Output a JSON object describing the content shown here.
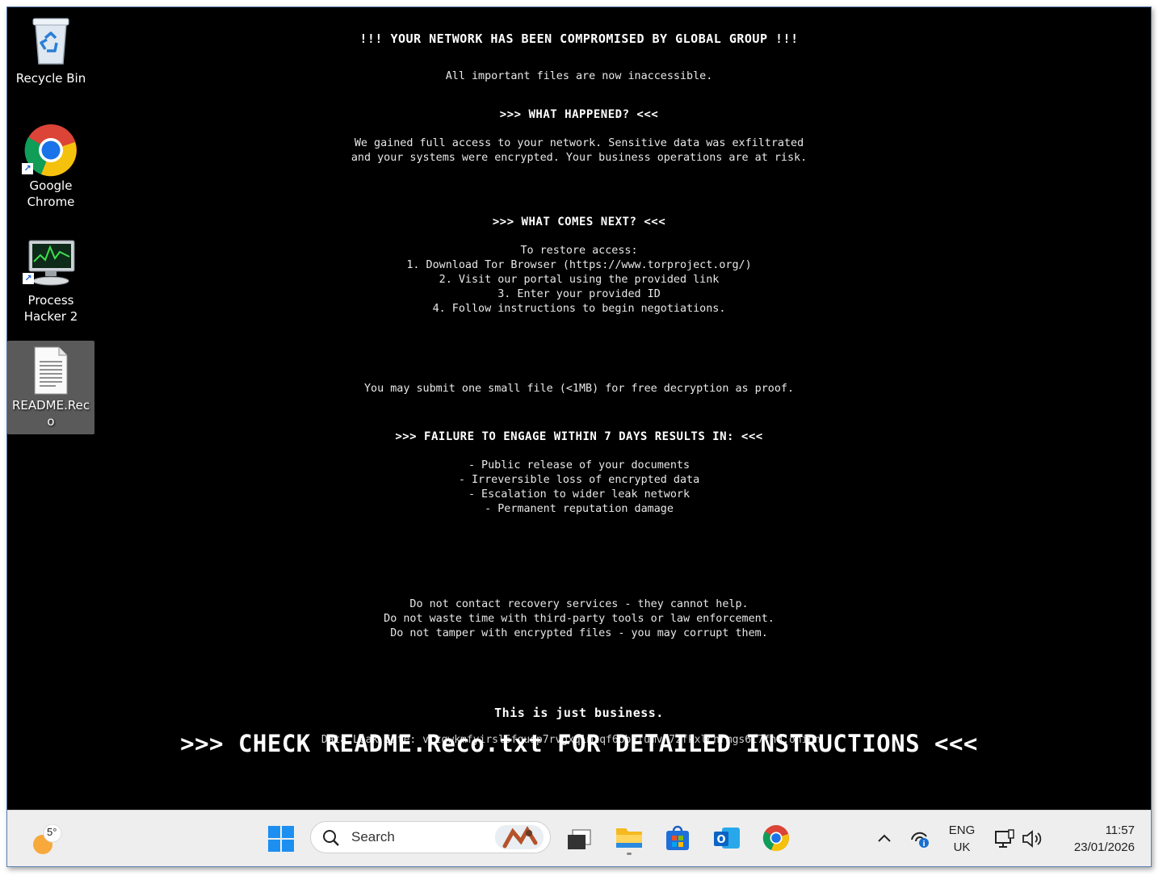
{
  "desktop": {
    "icons": [
      {
        "label": "Recycle Bin"
      },
      {
        "label": "Google\nChrome"
      },
      {
        "label": "Process\nHacker 2"
      },
      {
        "label": "README.Rec\no"
      }
    ]
  },
  "note": {
    "title": "!!! YOUR NETWORK HAS BEEN COMPROMISED BY GLOBAL GROUP !!!",
    "subtitle": "All important files are now inaccessible.",
    "what_happened_heading": ">>> WHAT HAPPENED? <<<",
    "what_happened_body": "We gained full access to your network. Sensitive data was exfiltrated\nand your systems were encrypted. Your business operations are at risk.",
    "next_heading": ">>> WHAT COMES NEXT? <<<",
    "next_body": "To restore access:\n1. Download Tor Browser (https://www.torproject.org/)\n2. Visit our portal using the provided link\n3. Enter your provided ID\n4. Follow instructions to begin negotiations.",
    "proof": "You may submit one small file (<1MB) for free decryption as proof.",
    "failure_heading": ">>> FAILURE TO ENGAGE WITHIN 7 DAYS RESULTS IN: <<<",
    "failure_body": "- Public release of your documents\n- Irreversible loss of encrypted data\n- Escalation to wider leak network\n- Permanent reputation damage",
    "warnings": "Do not contact recovery services - they cannot help.\nDo not waste time with third-party tools or law enforcement.\nDo not tamper with encrypted files - you may corrupt them.",
    "closing": "This is just business.",
    "check_readme": ">>> CHECK README.Reco.txt FOR DETAILED INSTRUCTIONS <<<",
    "leak_line_partial": "Data Leak Site: vlzgwkmfyirsl6fqusp7rvgxqlmzqf6obyfumvh7zfkxlcnrmgs6t7fhd.onion"
  },
  "taskbar": {
    "weather_temp": "5°",
    "search_placeholder": "Search",
    "lang_top": "ENG",
    "lang_bottom": "UK",
    "time": "11:57",
    "date": "23/01/2026"
  },
  "colors": {
    "desktop_bg": "#000000",
    "taskbar_bg": "#eeeeee",
    "note_text": "#e8e8e8"
  },
  "icons": [
    "recycle-bin-icon",
    "chrome-icon",
    "process-hacker-icon",
    "text-file-icon",
    "weather-icon",
    "windows-start-icon",
    "search-icon",
    "task-view-icon",
    "file-explorer-icon",
    "store-icon",
    "outlook-icon",
    "chrome-taskbar-icon",
    "chevron-up-icon",
    "network-icon",
    "display-icon",
    "volume-icon"
  ]
}
